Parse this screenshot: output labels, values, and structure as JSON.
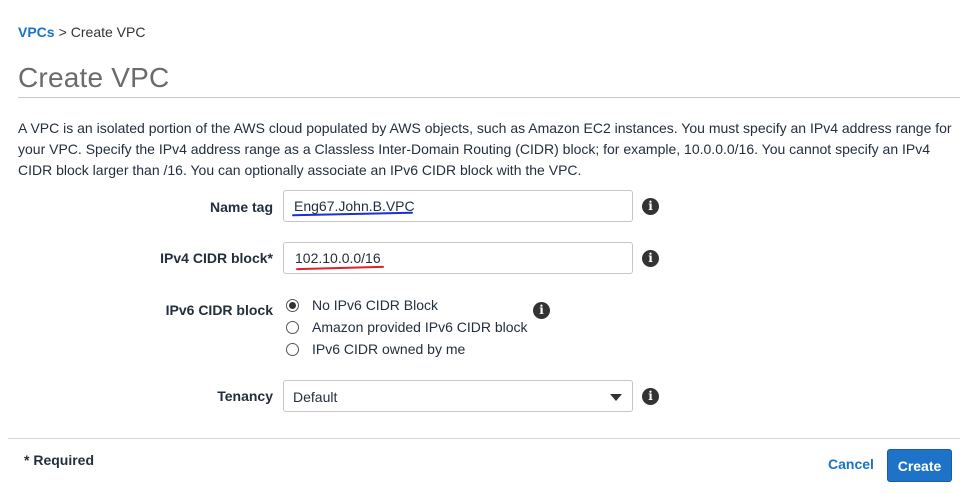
{
  "breadcrumb": {
    "parent": "VPCs",
    "separator": ">",
    "current": "Create VPC"
  },
  "page_title": "Create VPC",
  "description": "A VPC is an isolated portion of the AWS cloud populated by AWS objects, such as Amazon EC2 instances. You must specify an IPv4 address range for your VPC. Specify the IPv4 address range as a Classless Inter-Domain Routing (CIDR) block; for example, 10.0.0.0/16. You cannot specify an IPv4 CIDR block larger than /16. You can optionally associate an IPv6 CIDR block with the VPC.",
  "form": {
    "name_tag": {
      "label": "Name tag",
      "value": "Eng67.John.B.VPC",
      "annotation_color": "#1a2fd6"
    },
    "ipv4_cidr": {
      "label": "IPv4 CIDR block*",
      "value": "102.10.0.0/16",
      "annotation_color": "#e0202a"
    },
    "ipv6_cidr": {
      "label": "IPv6 CIDR block",
      "options": [
        "No IPv6 CIDR Block",
        "Amazon provided IPv6 CIDR block",
        "IPv6 CIDR owned by me"
      ],
      "selected_index": 0
    },
    "tenancy": {
      "label": "Tenancy",
      "selected": "Default"
    }
  },
  "info_icon_glyph": "i",
  "footer": {
    "required_note": "* Required",
    "cancel_label": "Cancel",
    "create_label": "Create"
  },
  "colors": {
    "link": "#1a73c5",
    "primary_button": "#1e72c8"
  }
}
